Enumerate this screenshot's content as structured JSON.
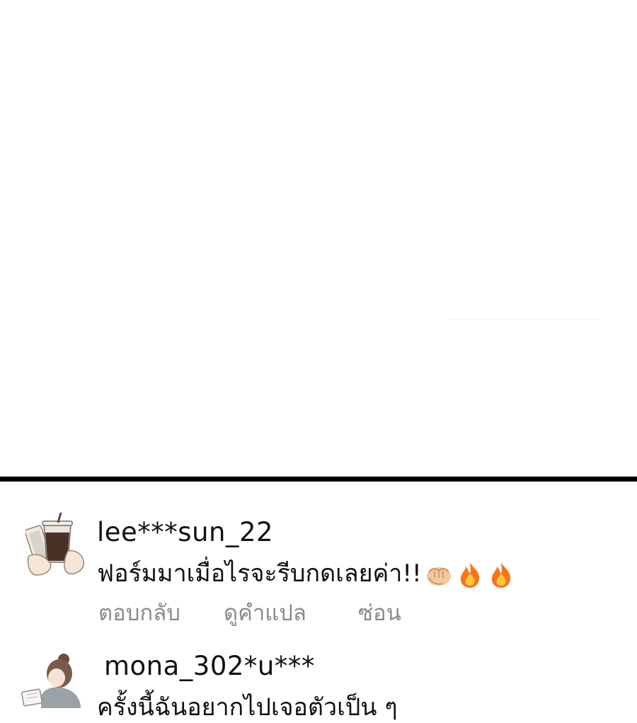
{
  "comments": [
    {
      "username": "lee***sun_22",
      "text": "ฟอร์มมาเมื่อไรจะรีบกดเลยค่า!!",
      "emojis": [
        "fist-emoji",
        "fire-emoji",
        "fire-emoji"
      ],
      "actions": {
        "reply": "ตอบกลับ",
        "translate": "ดูคำแปล",
        "hide": "ซ่อน"
      }
    },
    {
      "username": "mona_302*u***",
      "text": "ครั้งนี้ฉันอยากไปเจอตัวเป็น ๆ"
    }
  ],
  "colors": {
    "divider": "#000000",
    "username": "#111111",
    "text": "#111111",
    "action": "#8a8a8a"
  }
}
